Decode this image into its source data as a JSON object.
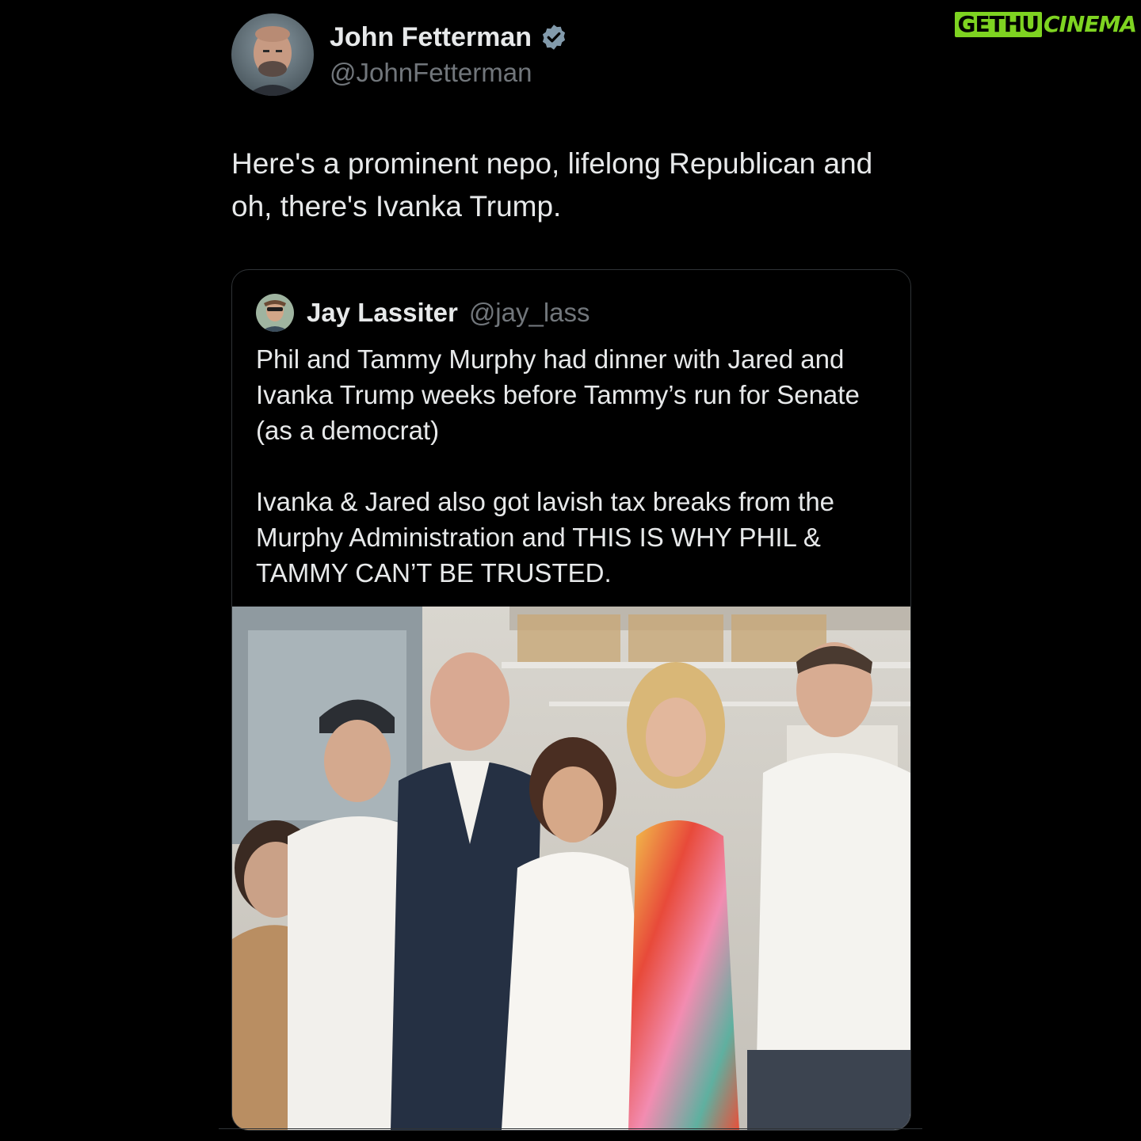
{
  "watermark": {
    "left": "GETHU",
    "right": "CINEMA",
    "color": "#7ed321"
  },
  "post": {
    "author": {
      "name": "John Fetterman",
      "handle": "@JohnFetterman",
      "verified": true,
      "avatar_icon": "profile-photo"
    },
    "text": "Here's a prominent nepo, lifelong Republican and oh, there's Ivanka Trump."
  },
  "quote": {
    "author": {
      "name": "Jay Lassiter",
      "handle": "@jay_lass",
      "avatar_icon": "profile-photo"
    },
    "paragraphs": [
      "Phil and Tammy Murphy had dinner with Jared and Ivanka Trump weeks before Tammy’s run for Senate (as a democrat)",
      "Ivanka & Jared also got lavish tax breaks from the Murphy Administration and THIS IS WHY PHIL & TAMMY CAN’T BE TRUSTED."
    ],
    "photo_icon": "group-photo-kitchen"
  },
  "colors": {
    "background": "#000000",
    "text_primary": "#e7e9ea",
    "text_secondary": "#71767b",
    "border": "#2f3336",
    "verified_badge": "#829aab"
  }
}
